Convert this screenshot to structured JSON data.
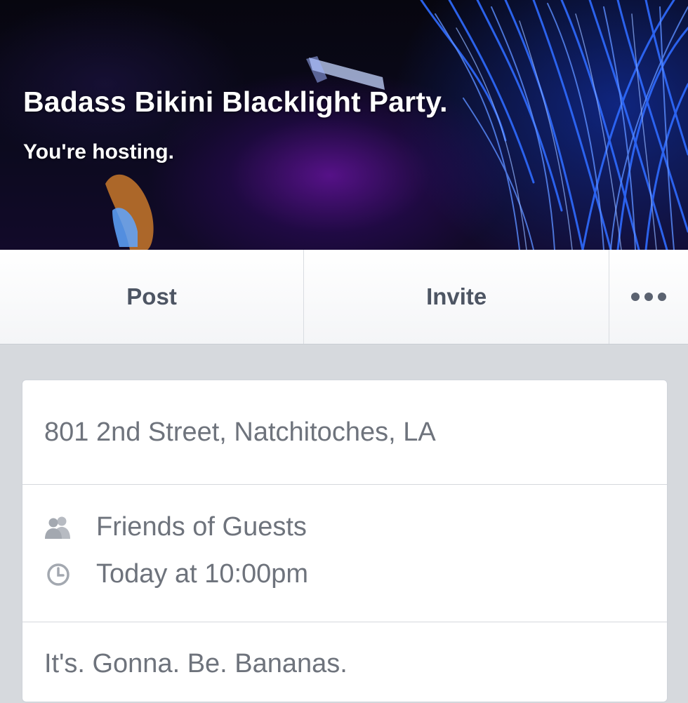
{
  "event": {
    "title": "Badass Bikini Blacklight Party.",
    "status": "You're hosting."
  },
  "actions": {
    "post_label": "Post",
    "invite_label": "Invite",
    "more_icon": "ellipsis-icon"
  },
  "details": {
    "address": "801 2nd Street, Natchitoches, LA",
    "privacy_icon": "friends-icon",
    "privacy": "Friends of Guests",
    "time_icon": "clock-icon",
    "time": "Today at 10:00pm",
    "description": "It's. Gonna. Be. Bananas."
  },
  "colors": {
    "cover_dark": "#0b0a1d",
    "cover_blue": "#2f6bff",
    "cover_purple": "#5a1a9e",
    "action_text": "#4d5563",
    "detail_text": "#6e737c",
    "page_background": "#d6d9dd"
  }
}
